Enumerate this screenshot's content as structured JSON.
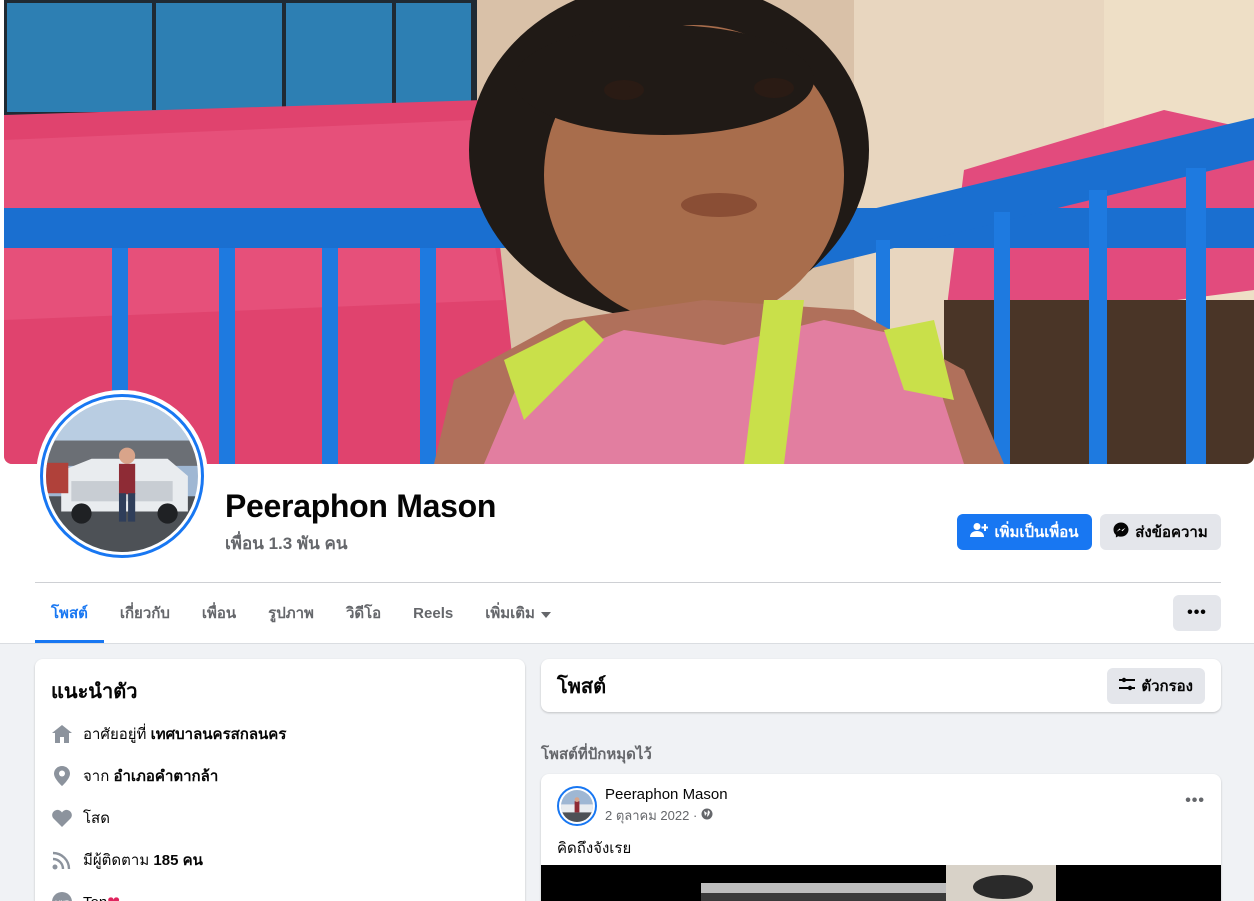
{
  "profile": {
    "name": "Peeraphon Mason",
    "friends": "เพื่อน 1.3 พัน คน"
  },
  "actions": {
    "add_friend": "เพิ่มเป็นเพื่อน",
    "message": "ส่งข้อความ"
  },
  "tabs": [
    {
      "label": "โพสต์",
      "active": true
    },
    {
      "label": "เกี่ยวกับ"
    },
    {
      "label": "เพื่อน"
    },
    {
      "label": "รูปภาพ"
    },
    {
      "label": "วิดีโอ"
    },
    {
      "label": "Reels"
    },
    {
      "label": "เพิ่มเติม"
    }
  ],
  "more_button": "•••",
  "intro": {
    "title": "แนะนำตัว",
    "lives_in_prefix": "อาศัยอยู่ที่",
    "lives_in": "เทศบาลนครสกลนคร",
    "from_prefix": "จาก",
    "from": "อำเภอคำตากล้า",
    "relationship": "โสด",
    "followers_prefix": "มีผู้ติดตาม",
    "followers": "185 คน",
    "line_id": "Ton"
  },
  "posts": {
    "title": "โพสต์",
    "filter": "ตัวกรอง",
    "pinned_label": "โพสต์ที่ปักหมุดไว้"
  },
  "post": {
    "author": "Peeraphon Mason",
    "date": "2 ตุลาคม 2022 ·",
    "text": "คิดถึงจังเรย",
    "menu": "•••"
  },
  "colors": {
    "accent": "#1877f2",
    "secondary_button": "#e4e6eb",
    "page_bg": "#f0f2f5"
  },
  "icons": {
    "home": "home-icon",
    "location": "location-pin-icon",
    "heart": "heart-icon",
    "followers": "rss-icon",
    "line": "line-icon",
    "globe": "globe-icon",
    "filter": "sliders-icon",
    "messenger": "messenger-icon",
    "add_friend": "person-add-icon"
  }
}
